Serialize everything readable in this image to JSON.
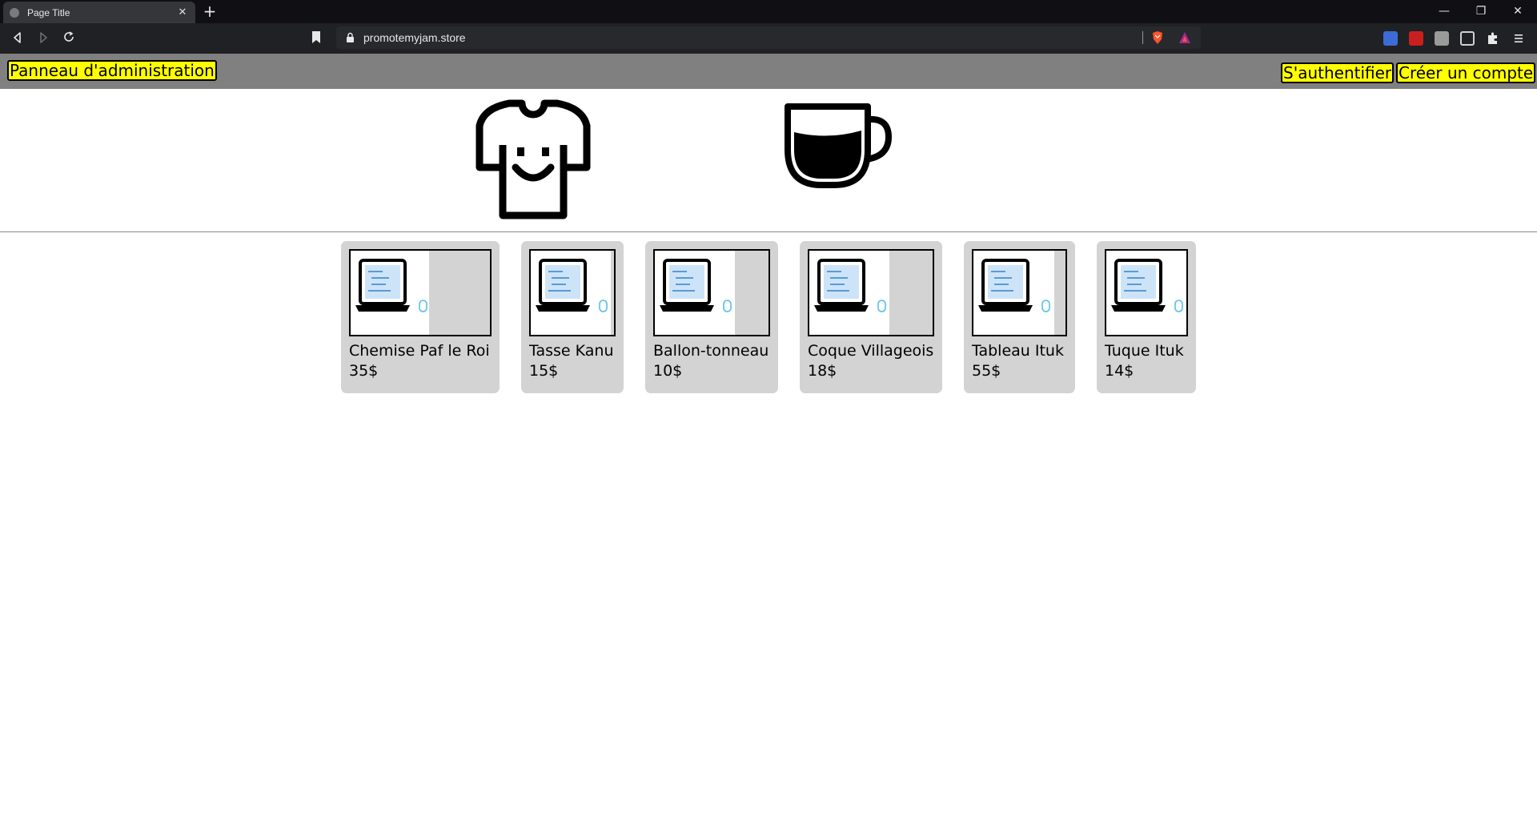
{
  "browser": {
    "tab_title": "Page Title",
    "tab_close": "✕",
    "new_tab": "+",
    "url": "promotemyjam.store",
    "window_controls": [
      "—",
      "❐",
      "✕"
    ]
  },
  "header": {
    "admin_label": "Panneau d'administration",
    "login_label": "S'authentifier",
    "signup_label": "Créer un compte"
  },
  "categories": [
    {
      "icon": "tshirt-icon"
    },
    {
      "icon": "coffee-cup-icon"
    }
  ],
  "products": [
    {
      "name": "Chemise Paf le Roi",
      "price": "35$"
    },
    {
      "name": "Tasse Kanu",
      "price": "15$"
    },
    {
      "name": "Ballon-tonneau",
      "price": "10$"
    },
    {
      "name": "Coque Villageois",
      "price": "18$"
    },
    {
      "name": "Tableau Ituk",
      "price": "55$"
    },
    {
      "name": "Tuque Ituk",
      "price": "14$"
    }
  ],
  "colors": {
    "header_bg": "#808080",
    "button_bg": "#ffff00",
    "card_bg": "#d3d3d3",
    "chrome_dark": "#202124"
  }
}
